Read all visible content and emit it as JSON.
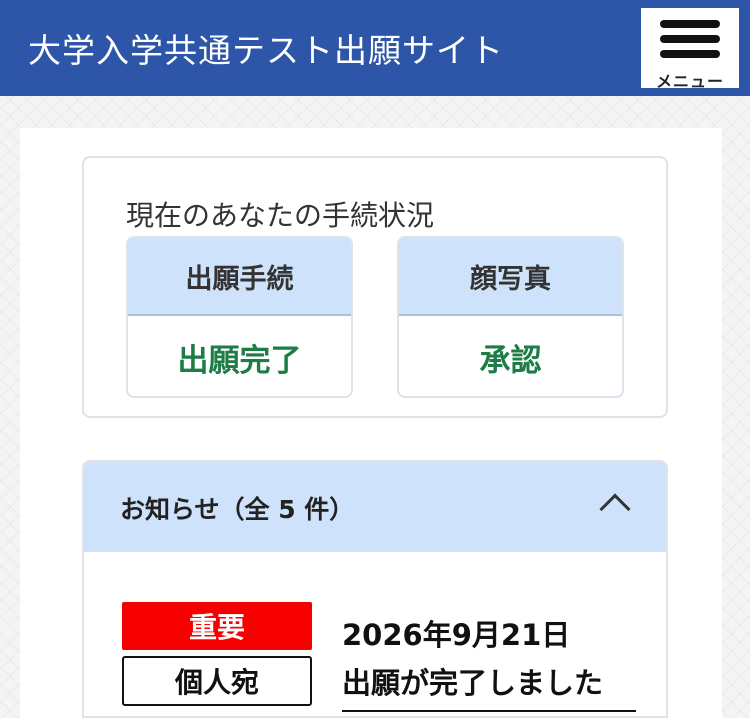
{
  "header": {
    "title": "大学入学共通テスト出願サイト",
    "menu_label": "メニュー",
    "menu_icon": "hamburger-menu-icon",
    "brand_color": "#2d56a8"
  },
  "status": {
    "heading": "現在のあなたの手続状況",
    "items": [
      {
        "label": "出願手続",
        "value": "出願完了"
      },
      {
        "label": "顔写真",
        "value": "承認"
      }
    ],
    "value_color": "#1e7c45"
  },
  "notices": {
    "title": "お知らせ（全 5 件）",
    "collapse_icon": "chevron-up-icon",
    "items": [
      {
        "badge_important": "重要",
        "badge_personal": "個人宛",
        "date": "2026年9月21日",
        "title": "出願が完了しました"
      }
    ],
    "important_color": "#f70000"
  }
}
